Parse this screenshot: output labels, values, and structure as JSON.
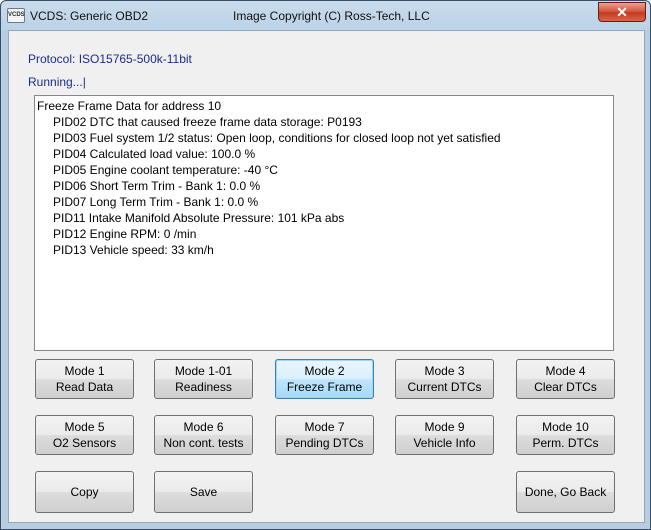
{
  "window": {
    "title": "VCDS:  Generic OBD2",
    "copyright": "Image Copyright (C) Ross-Tech, LLC",
    "icon_label": "VCDS",
    "close_label": "✕"
  },
  "protocol_text": "Protocol: ISO15765-500k-11bit",
  "status_text": "Running...|",
  "output": {
    "heading": "Freeze Frame Data for address 10",
    "lines": [
      "PID02 DTC that caused freeze frame data storage: P0193",
      "PID03 Fuel system 1/2 status: Open loop, conditions for closed loop not yet satisfied",
      "PID04 Calculated load value: 100.0 %",
      "PID05 Engine coolant temperature: -40 °C",
      "PID06 Short Term Trim - Bank 1: 0.0 %",
      "PID07 Long Term Trim - Bank 1: 0.0 %",
      "PID11 Intake Manifold Absolute Pressure: 101 kPa abs",
      "PID12 Engine RPM: 0 /min",
      "PID13 Vehicle speed: 33 km/h"
    ]
  },
  "buttons": {
    "mode1": {
      "l1": "Mode 1",
      "l2": "Read Data"
    },
    "mode101": {
      "l1": "Mode 1-01",
      "l2": "Readiness"
    },
    "mode2": {
      "l1": "Mode 2",
      "l2": "Freeze Frame"
    },
    "mode3": {
      "l1": "Mode 3",
      "l2": "Current DTCs"
    },
    "mode4": {
      "l1": "Mode 4",
      "l2": "Clear DTCs"
    },
    "mode5": {
      "l1": "Mode 5",
      "l2": "O2 Sensors"
    },
    "mode6": {
      "l1": "Mode 6",
      "l2": "Non cont. tests"
    },
    "mode7": {
      "l1": "Mode 7",
      "l2": "Pending DTCs"
    },
    "mode9": {
      "l1": "Mode 9",
      "l2": "Vehicle Info"
    },
    "mode10": {
      "l1": "Mode 10",
      "l2": "Perm. DTCs"
    },
    "copy": "Copy",
    "save": "Save",
    "done": "Done, Go Back"
  }
}
